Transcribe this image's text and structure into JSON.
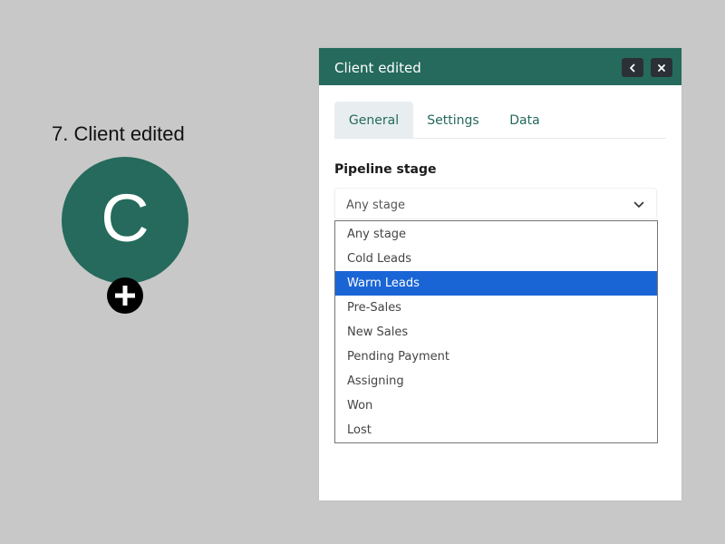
{
  "node": {
    "title": "7. Client edited",
    "letter": "C",
    "add_icon": "plus-icon",
    "color": "#256a5c"
  },
  "panel": {
    "title": "Client edited",
    "header_color": "#256a5c",
    "back_icon": "chevron-left-icon",
    "close_icon": "close-icon",
    "tabs": [
      {
        "label": "General",
        "active": true
      },
      {
        "label": "Settings",
        "active": false
      },
      {
        "label": "Data",
        "active": false
      }
    ],
    "field": {
      "label": "Pipeline stage",
      "value": "Any stage",
      "options": [
        {
          "label": "Any stage"
        },
        {
          "label": "Cold Leads"
        },
        {
          "label": "Warm Leads",
          "highlighted": true
        },
        {
          "label": "Pre-Sales"
        },
        {
          "label": "New Sales"
        },
        {
          "label": "Pending Payment"
        },
        {
          "label": "Assigning"
        },
        {
          "label": "Won"
        },
        {
          "label": "Lost"
        }
      ],
      "highlight_color": "#1a65d6"
    }
  }
}
